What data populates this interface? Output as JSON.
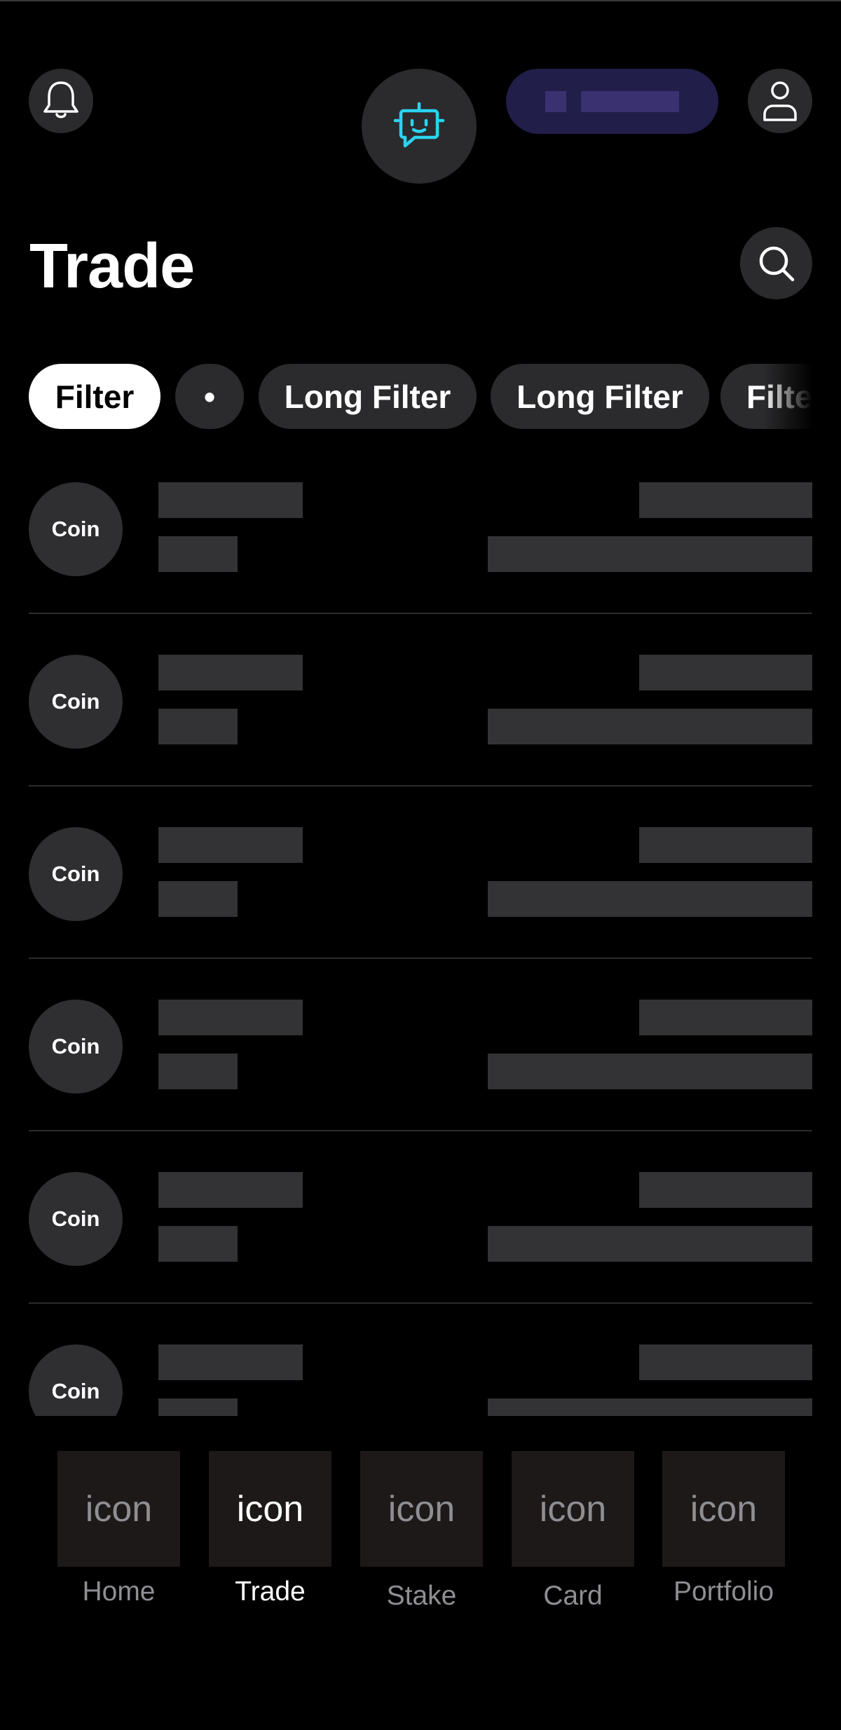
{
  "colors": {
    "background": "#000000",
    "accent_bot": "#2ad4f0",
    "promo_pill": "#221e4a",
    "skeleton": "#333335"
  },
  "header": {
    "notifications_icon": "bell-icon",
    "assistant_icon": "chat-bot-icon",
    "profile_icon": "user-icon"
  },
  "page": {
    "title": "Trade",
    "search_icon": "search-icon"
  },
  "filters": [
    {
      "label": "Filter",
      "active": true
    },
    {
      "label": "•",
      "active": false
    },
    {
      "label": "Long Filter",
      "active": false
    },
    {
      "label": "Long Filter",
      "active": false
    },
    {
      "label": "Filter",
      "active": false
    }
  ],
  "coins": [
    {
      "label": "Coin"
    },
    {
      "label": "Coin"
    },
    {
      "label": "Coin"
    },
    {
      "label": "Coin"
    },
    {
      "label": "Coin"
    },
    {
      "label": "Coin"
    }
  ],
  "tabbar": [
    {
      "icon": "icon",
      "label": "Home",
      "active": false
    },
    {
      "icon": "icon",
      "label": "Trade",
      "active": true
    },
    {
      "icon": "icon",
      "label": "Stake",
      "active": false
    },
    {
      "icon": "icon",
      "label": "Card",
      "active": false
    },
    {
      "icon": "icon",
      "label": "Portfolio",
      "active": false
    }
  ]
}
